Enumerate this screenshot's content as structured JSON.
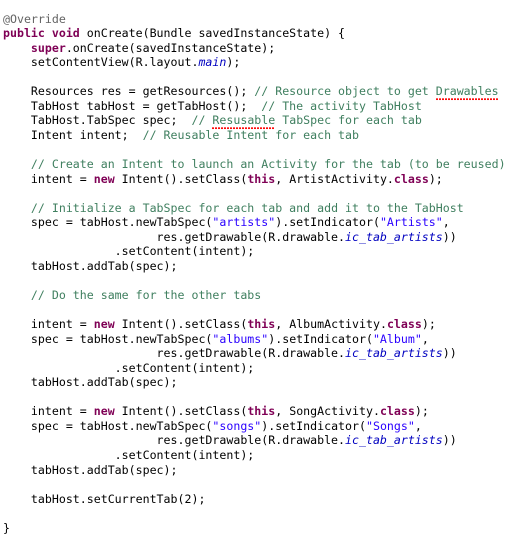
{
  "editor": {
    "language": "java",
    "background_color": "#ffffff",
    "font_size_px": 11.6,
    "line_height_px": 14.55,
    "colors": {
      "plain": "#000000",
      "keyword": "#7f0055",
      "comment": "#3f7f5f",
      "string": "#2a00ff",
      "static_field": "#0000c0",
      "annotation": "#646464",
      "spellcheck_underline": "#ff0000"
    }
  },
  "code": {
    "lines": [
      "@Override",
      "public void onCreate(Bundle savedInstanceState) {",
      "    super.onCreate(savedInstanceState);",
      "    setContentView(R.layout.main);",
      "",
      "    Resources res = getResources(); // Resource object to get Drawables",
      "    TabHost tabHost = getTabHost();  // The activity TabHost",
      "    TabHost.TabSpec spec;  // Resusable TabSpec for each tab",
      "    Intent intent;  // Reusable Intent for each tab",
      "",
      "    // Create an Intent to launch an Activity for the tab (to be reused)",
      "    intent = new Intent().setClass(this, ArtistActivity.class);",
      "",
      "    // Initialize a TabSpec for each tab and add it to the TabHost",
      "    spec = tabHost.newTabSpec(\"artists\").setIndicator(\"Artists\",",
      "                      res.getDrawable(R.drawable.ic_tab_artists))",
      "                .setContent(intent);",
      "    tabHost.addTab(spec);",
      "",
      "    // Do the same for the other tabs",
      "",
      "    intent = new Intent().setClass(this, AlbumActivity.class);",
      "    spec = tabHost.newTabSpec(\"albums\").setIndicator(\"Album\",",
      "                      res.getDrawable(R.drawable.ic_tab_artists))",
      "                .setContent(intent);",
      "    tabHost.addTab(spec);",
      "",
      "    intent = new Intent().setClass(this, SongActivity.class);",
      "    spec = tabHost.newTabSpec(\"songs\").setIndicator(\"Songs\",",
      "                      res.getDrawable(R.drawable.ic_tab_artists))",
      "                .setContent(intent);",
      "    tabHost.addTab(spec);",
      "",
      "    tabHost.setCurrentTab(2);",
      "",
      "}"
    ],
    "tokens": [
      [
        {
          "t": "@Override",
          "c": "annot"
        }
      ],
      [
        {
          "t": "public void",
          "c": "keyword"
        },
        {
          "t": " onCreate(Bundle savedInstanceState) {",
          "c": "plain"
        }
      ],
      [
        {
          "t": "    ",
          "c": "plain"
        },
        {
          "t": "super",
          "c": "keyword"
        },
        {
          "t": ".onCreate(savedInstanceState);",
          "c": "plain"
        }
      ],
      [
        {
          "t": "    setContentView(R.layout.",
          "c": "plain"
        },
        {
          "t": "main",
          "c": "static"
        },
        {
          "t": ");",
          "c": "plain"
        }
      ],
      [
        {
          "t": "",
          "c": "plain"
        }
      ],
      [
        {
          "t": "    Resources res = getResources(); ",
          "c": "plain"
        },
        {
          "t": "// Resource object to get ",
          "c": "comment"
        },
        {
          "t": "Drawables",
          "c": "comment",
          "spell": true
        }
      ],
      [
        {
          "t": "    TabHost tabHost = getTabHost();  ",
          "c": "plain"
        },
        {
          "t": "// The activity TabHost",
          "c": "comment"
        }
      ],
      [
        {
          "t": "    TabHost.TabSpec spec;  ",
          "c": "plain"
        },
        {
          "t": "// ",
          "c": "comment"
        },
        {
          "t": "Resusable",
          "c": "comment",
          "spell": true
        },
        {
          "t": " TabSpec for each tab",
          "c": "comment"
        }
      ],
      [
        {
          "t": "    Intent intent;  ",
          "c": "plain"
        },
        {
          "t": "// Reusable Intent for each tab",
          "c": "comment"
        }
      ],
      [
        {
          "t": "",
          "c": "plain"
        }
      ],
      [
        {
          "t": "    ",
          "c": "plain"
        },
        {
          "t": "// Create an Intent to launch an Activity for the tab (to be reused)",
          "c": "comment"
        }
      ],
      [
        {
          "t": "    intent = ",
          "c": "plain"
        },
        {
          "t": "new",
          "c": "keyword"
        },
        {
          "t": " Intent().setClass(",
          "c": "plain"
        },
        {
          "t": "this",
          "c": "keyword"
        },
        {
          "t": ", ArtistActivity.",
          "c": "plain"
        },
        {
          "t": "class",
          "c": "keyword"
        },
        {
          "t": ");",
          "c": "plain"
        }
      ],
      [
        {
          "t": "",
          "c": "plain"
        }
      ],
      [
        {
          "t": "    ",
          "c": "plain"
        },
        {
          "t": "// Initialize a TabSpec for each tab and add it to the TabHost",
          "c": "comment"
        }
      ],
      [
        {
          "t": "    spec = tabHost.newTabSpec(",
          "c": "plain"
        },
        {
          "t": "\"artists\"",
          "c": "string"
        },
        {
          "t": ").setIndicator(",
          "c": "plain"
        },
        {
          "t": "\"Artists\"",
          "c": "string"
        },
        {
          "t": ",",
          "c": "plain"
        }
      ],
      [
        {
          "t": "                      res.getDrawable(R.drawable.",
          "c": "plain"
        },
        {
          "t": "ic_tab_artists",
          "c": "static"
        },
        {
          "t": "))",
          "c": "plain"
        }
      ],
      [
        {
          "t": "                .setContent(intent);",
          "c": "plain"
        }
      ],
      [
        {
          "t": "    tabHost.addTab(spec);",
          "c": "plain"
        }
      ],
      [
        {
          "t": "",
          "c": "plain"
        }
      ],
      [
        {
          "t": "    ",
          "c": "plain"
        },
        {
          "t": "// Do the same for the other tabs",
          "c": "comment"
        }
      ],
      [
        {
          "t": "",
          "c": "plain"
        }
      ],
      [
        {
          "t": "    intent = ",
          "c": "plain"
        },
        {
          "t": "new",
          "c": "keyword"
        },
        {
          "t": " Intent().setClass(",
          "c": "plain"
        },
        {
          "t": "this",
          "c": "keyword"
        },
        {
          "t": ", AlbumActivity.",
          "c": "plain"
        },
        {
          "t": "class",
          "c": "keyword"
        },
        {
          "t": ");",
          "c": "plain"
        }
      ],
      [
        {
          "t": "    spec = tabHost.newTabSpec(",
          "c": "plain"
        },
        {
          "t": "\"albums\"",
          "c": "string"
        },
        {
          "t": ").setIndicator(",
          "c": "plain"
        },
        {
          "t": "\"Album\"",
          "c": "string"
        },
        {
          "t": ",",
          "c": "plain"
        }
      ],
      [
        {
          "t": "                      res.getDrawable(R.drawable.",
          "c": "plain"
        },
        {
          "t": "ic_tab_artists",
          "c": "static"
        },
        {
          "t": "))",
          "c": "plain"
        }
      ],
      [
        {
          "t": "                .setContent(intent);",
          "c": "plain"
        }
      ],
      [
        {
          "t": "    tabHost.addTab(spec);",
          "c": "plain"
        }
      ],
      [
        {
          "t": "",
          "c": "plain"
        }
      ],
      [
        {
          "t": "    intent = ",
          "c": "plain"
        },
        {
          "t": "new",
          "c": "keyword"
        },
        {
          "t": " Intent().setClass(",
          "c": "plain"
        },
        {
          "t": "this",
          "c": "keyword"
        },
        {
          "t": ", SongActivity.",
          "c": "plain"
        },
        {
          "t": "class",
          "c": "keyword"
        },
        {
          "t": ");",
          "c": "plain"
        }
      ],
      [
        {
          "t": "    spec = tabHost.newTabSpec(",
          "c": "plain"
        },
        {
          "t": "\"songs\"",
          "c": "string"
        },
        {
          "t": ").setIndicator(",
          "c": "plain"
        },
        {
          "t": "\"Songs\"",
          "c": "string"
        },
        {
          "t": ",",
          "c": "plain"
        }
      ],
      [
        {
          "t": "                      res.getDrawable(R.drawable.",
          "c": "plain"
        },
        {
          "t": "ic_tab_artists",
          "c": "static"
        },
        {
          "t": "))",
          "c": "plain"
        }
      ],
      [
        {
          "t": "                .setContent(intent);",
          "c": "plain"
        }
      ],
      [
        {
          "t": "    tabHost.addTab(spec);",
          "c": "plain"
        }
      ],
      [
        {
          "t": "",
          "c": "plain"
        }
      ],
      [
        {
          "t": "    tabHost.setCurrentTab(2);",
          "c": "plain"
        }
      ],
      [
        {
          "t": "",
          "c": "plain"
        }
      ],
      [
        {
          "t": "}",
          "c": "plain"
        }
      ]
    ]
  }
}
